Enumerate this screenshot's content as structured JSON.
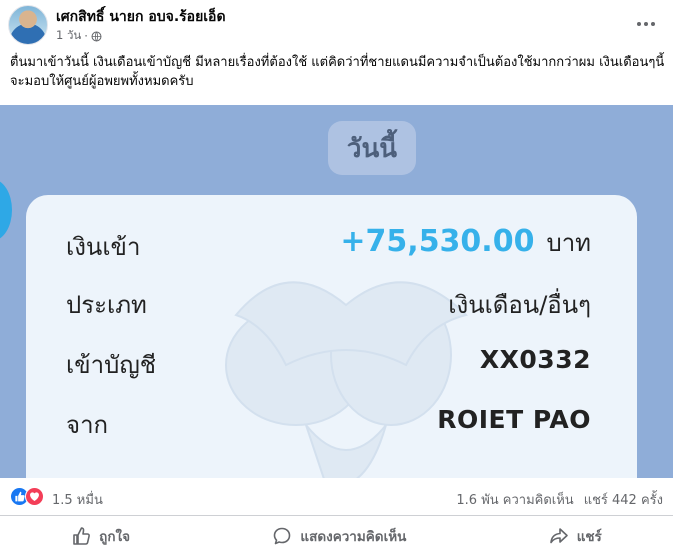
{
  "post": {
    "author": "เศกสิทธิ์ นายก อบจ.ร้อยเอ็ด",
    "time": "1 วัน",
    "separator": "·",
    "text": "ตื่นมาเข้าวันนี้ เงินเดือนเข้าบัญชี มีหลายเรื่องที่ต้องใช้ แต่คิดว่าที่ชายแดนมีความจำเป็นต้องใช้มากกว่าผม เงินเดือนๆนี้จะมอบให้ศูนย์ผู้อพยพทั้งหมดครับ"
  },
  "image": {
    "today_label": "วันนี้",
    "rows": {
      "income_label": "เงินเข้า",
      "income_amount": "+75,530.00",
      "income_unit": "บาท",
      "type_label": "ประเภท",
      "type_value": "เงินเดือน/อื่นๆ",
      "account_label": "เข้าบัญชี",
      "account_value": "XX0332",
      "from_label": "จาก",
      "from_value": "ROIET PAO"
    }
  },
  "stats": {
    "reactions": "1.5 หมื่น",
    "comments": "1.6 พัน ความคิดเห็น",
    "shares": "แชร์ 442 ครั้ง"
  },
  "actions": {
    "like": "ถูกใจ",
    "comment": "แสดงความคิดเห็น",
    "share": "แชร์"
  },
  "colors": {
    "accent": "#1877f2",
    "love": "#f33e58",
    "amount": "#36b1ea",
    "photo_bg": "#8fadd8"
  }
}
